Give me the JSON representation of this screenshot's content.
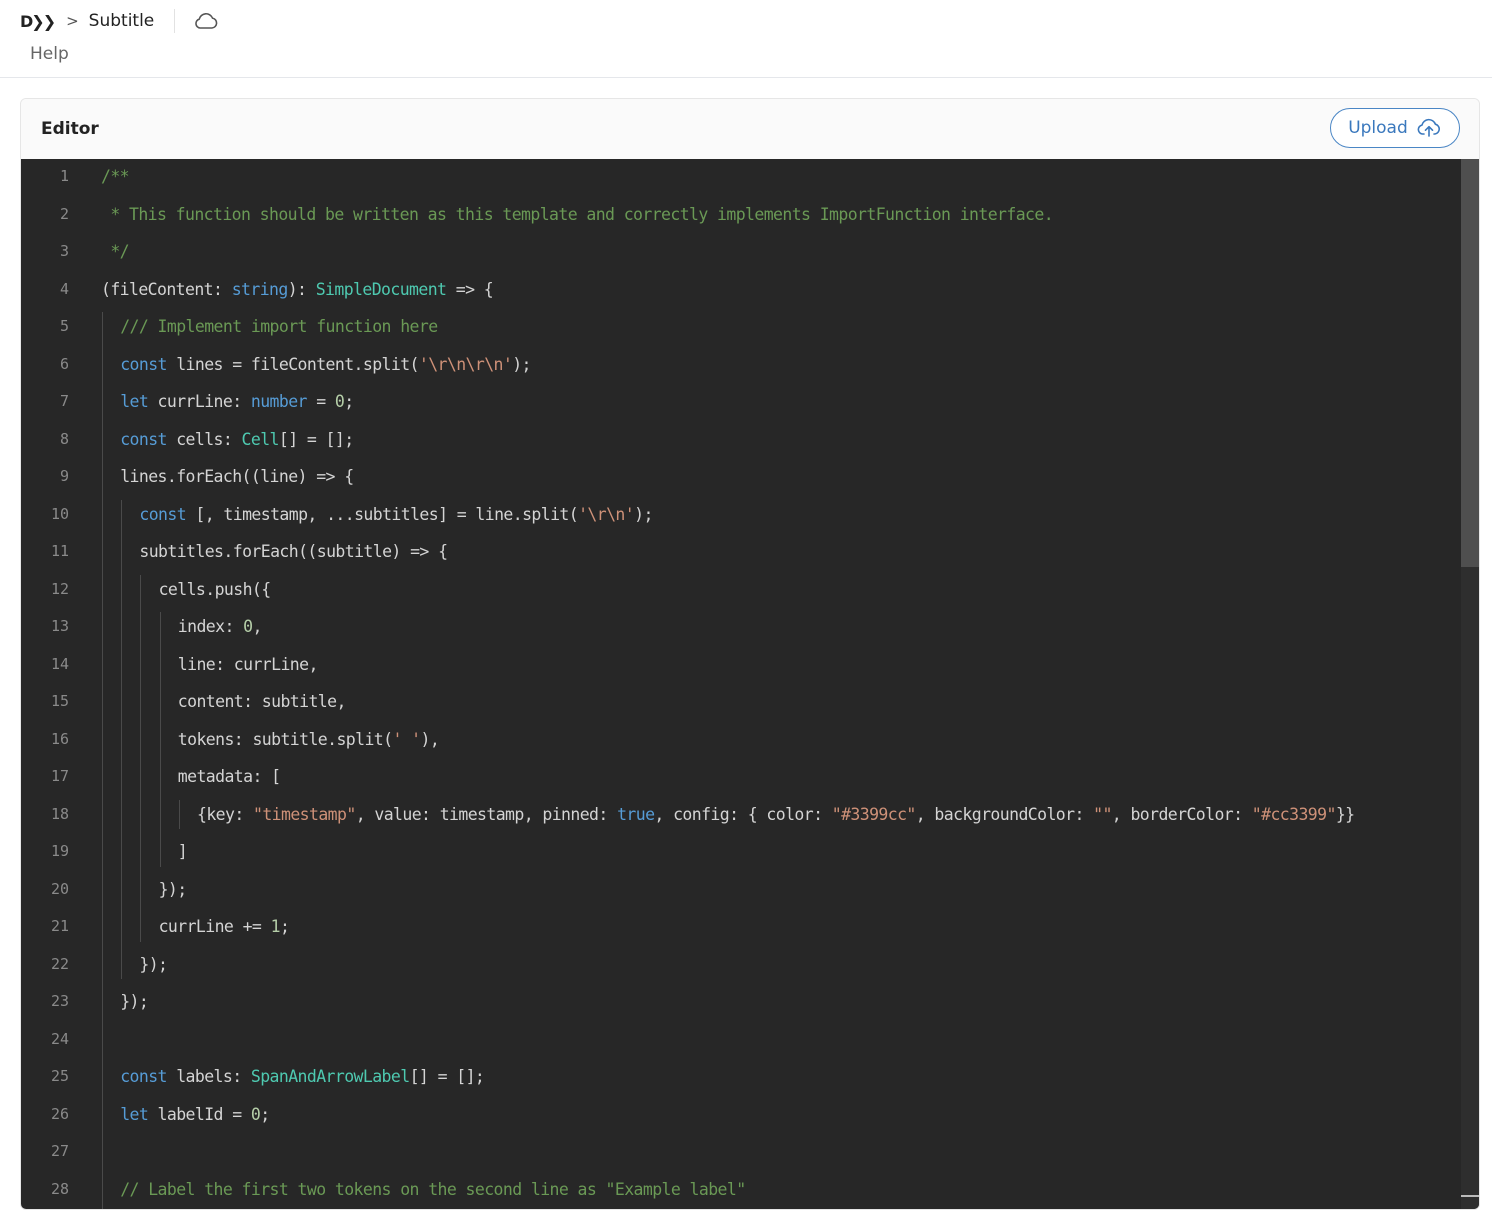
{
  "header": {
    "logo_text": "D❯❯",
    "breadcrumb_separator": ">",
    "title": "Subtitle",
    "cloud_icon": "cloud-icon",
    "help_label": "Help"
  },
  "card": {
    "title": "Editor",
    "upload_label": "Upload",
    "upload_icon": "cloud-upload-icon"
  },
  "editor": {
    "lines": [
      {
        "n": "1",
        "indent": 0,
        "tokens": [
          {
            "t": "/**",
            "c": "comment"
          }
        ]
      },
      {
        "n": "2",
        "indent": 0,
        "tokens": [
          {
            "t": " * This function should be written as this template and correctly implements ImportFunction interface.",
            "c": "comment"
          }
        ]
      },
      {
        "n": "3",
        "indent": 0,
        "tokens": [
          {
            "t": " */",
            "c": "comment"
          }
        ]
      },
      {
        "n": "4",
        "indent": 0,
        "tokens": [
          {
            "t": "(fileContent: ",
            "c": "prop"
          },
          {
            "t": "string",
            "c": "kw"
          },
          {
            "t": "): ",
            "c": "prop"
          },
          {
            "t": "SimpleDocument",
            "c": "type"
          },
          {
            "t": " => {",
            "c": "prop"
          }
        ]
      },
      {
        "n": "5",
        "indent": 1,
        "tokens": [
          {
            "t": "/// Implement import function here",
            "c": "comment"
          }
        ]
      },
      {
        "n": "6",
        "indent": 1,
        "tokens": [
          {
            "t": "const",
            "c": "kw"
          },
          {
            "t": " lines = fileContent.split(",
            "c": "prop"
          },
          {
            "t": "'\\r\\n\\r\\n'",
            "c": "str"
          },
          {
            "t": ");",
            "c": "prop"
          }
        ]
      },
      {
        "n": "7",
        "indent": 1,
        "tokens": [
          {
            "t": "let",
            "c": "kw"
          },
          {
            "t": " currLine: ",
            "c": "prop"
          },
          {
            "t": "number",
            "c": "kw"
          },
          {
            "t": " = ",
            "c": "prop"
          },
          {
            "t": "0",
            "c": "num"
          },
          {
            "t": ";",
            "c": "prop"
          }
        ]
      },
      {
        "n": "8",
        "indent": 1,
        "tokens": [
          {
            "t": "const",
            "c": "kw"
          },
          {
            "t": " cells: ",
            "c": "prop"
          },
          {
            "t": "Cell",
            "c": "type"
          },
          {
            "t": "[] = [];",
            "c": "prop"
          }
        ]
      },
      {
        "n": "9",
        "indent": 1,
        "tokens": [
          {
            "t": "lines.forEach((line) => {",
            "c": "prop"
          }
        ]
      },
      {
        "n": "10",
        "indent": 2,
        "tokens": [
          {
            "t": "const",
            "c": "kw"
          },
          {
            "t": " [, timestamp, ...subtitles] = line.split(",
            "c": "prop"
          },
          {
            "t": "'\\r\\n'",
            "c": "str"
          },
          {
            "t": ");",
            "c": "prop"
          }
        ]
      },
      {
        "n": "11",
        "indent": 2,
        "tokens": [
          {
            "t": "subtitles.forEach((subtitle) => {",
            "c": "prop"
          }
        ]
      },
      {
        "n": "12",
        "indent": 3,
        "tokens": [
          {
            "t": "cells.push({",
            "c": "prop"
          }
        ]
      },
      {
        "n": "13",
        "indent": 4,
        "tokens": [
          {
            "t": "index: ",
            "c": "prop"
          },
          {
            "t": "0",
            "c": "num"
          },
          {
            "t": ",",
            "c": "prop"
          }
        ]
      },
      {
        "n": "14",
        "indent": 4,
        "tokens": [
          {
            "t": "line: currLine,",
            "c": "prop"
          }
        ]
      },
      {
        "n": "15",
        "indent": 4,
        "tokens": [
          {
            "t": "content: subtitle,",
            "c": "prop"
          }
        ]
      },
      {
        "n": "16",
        "indent": 4,
        "tokens": [
          {
            "t": "tokens: subtitle.split(",
            "c": "prop"
          },
          {
            "t": "' '",
            "c": "str"
          },
          {
            "t": "),",
            "c": "prop"
          }
        ]
      },
      {
        "n": "17",
        "indent": 4,
        "tokens": [
          {
            "t": "metadata: [",
            "c": "prop"
          }
        ]
      },
      {
        "n": "18",
        "indent": 5,
        "tokens": [
          {
            "t": "{key: ",
            "c": "prop"
          },
          {
            "t": "\"timestamp\"",
            "c": "str"
          },
          {
            "t": ", value: timestamp, pinned: ",
            "c": "prop"
          },
          {
            "t": "true",
            "c": "kw"
          },
          {
            "t": ", config: { color: ",
            "c": "prop"
          },
          {
            "t": "\"#3399cc\"",
            "c": "str"
          },
          {
            "t": ", backgroundColor: ",
            "c": "prop"
          },
          {
            "t": "\"\"",
            "c": "str"
          },
          {
            "t": ", borderColor: ",
            "c": "prop"
          },
          {
            "t": "\"#cc3399\"",
            "c": "str"
          },
          {
            "t": "}}",
            "c": "prop"
          }
        ]
      },
      {
        "n": "19",
        "indent": 4,
        "tokens": [
          {
            "t": "]",
            "c": "prop"
          }
        ]
      },
      {
        "n": "20",
        "indent": 3,
        "tokens": [
          {
            "t": "});",
            "c": "prop"
          }
        ]
      },
      {
        "n": "21",
        "indent": 3,
        "tokens": [
          {
            "t": "currLine += ",
            "c": "prop"
          },
          {
            "t": "1",
            "c": "num"
          },
          {
            "t": ";",
            "c": "prop"
          }
        ]
      },
      {
        "n": "22",
        "indent": 2,
        "tokens": [
          {
            "t": "});",
            "c": "prop"
          }
        ]
      },
      {
        "n": "23",
        "indent": 1,
        "tokens": [
          {
            "t": "});",
            "c": "prop"
          }
        ]
      },
      {
        "n": "24",
        "indent": 1,
        "tokens": []
      },
      {
        "n": "25",
        "indent": 1,
        "tokens": [
          {
            "t": "const",
            "c": "kw"
          },
          {
            "t": " labels: ",
            "c": "prop"
          },
          {
            "t": "SpanAndArrowLabel",
            "c": "type"
          },
          {
            "t": "[] = [];",
            "c": "prop"
          }
        ]
      },
      {
        "n": "26",
        "indent": 1,
        "tokens": [
          {
            "t": "let",
            "c": "kw"
          },
          {
            "t": " labelId = ",
            "c": "prop"
          },
          {
            "t": "0",
            "c": "num"
          },
          {
            "t": ";",
            "c": "prop"
          }
        ]
      },
      {
        "n": "27",
        "indent": 1,
        "tokens": []
      },
      {
        "n": "28",
        "indent": 1,
        "tokens": [
          {
            "t": "// Label the first two tokens on the second line as \"Example label\"",
            "c": "comment"
          }
        ]
      }
    ]
  }
}
